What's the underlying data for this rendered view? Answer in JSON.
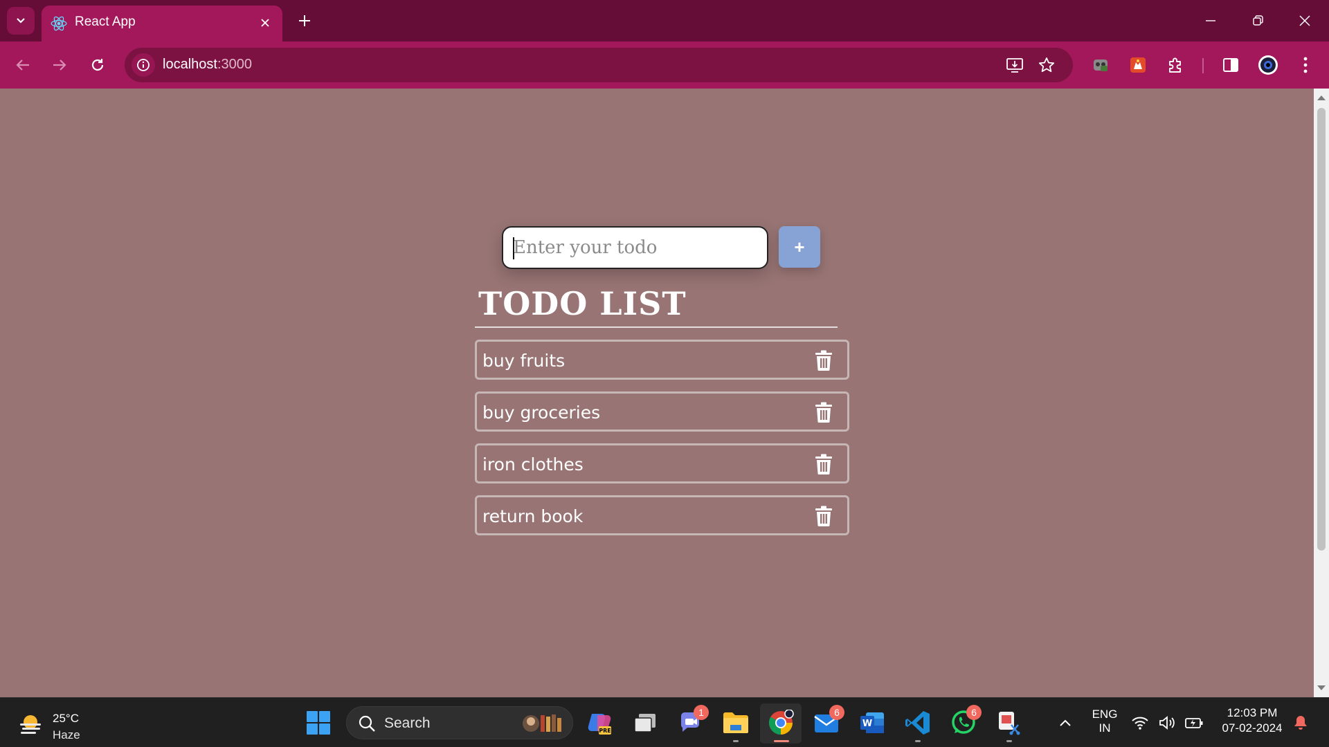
{
  "browser": {
    "tab_title": "React App",
    "url_host": "localhost",
    "url_port": ":3000"
  },
  "app": {
    "input_placeholder": "Enter your todo",
    "add_label": "+",
    "heading": "TODO LIST",
    "todos": [
      {
        "text": "buy fruits"
      },
      {
        "text": "buy groceries"
      },
      {
        "text": "iron clothes"
      },
      {
        "text": "return book"
      }
    ]
  },
  "taskbar": {
    "weather_temp": "25°C",
    "weather_condition": "Haze",
    "search_label": "Search",
    "teams_badge": "1",
    "mail_badge": "6",
    "whatsapp_badge": "6",
    "lang": "ENG",
    "region": "IN",
    "time": "12:03 PM",
    "date": "07-02-2024"
  },
  "colors": {
    "tab_strip": "#650c37",
    "toolbar": "#a3185b",
    "page_background": "#987474",
    "add_button": "#87a3d6"
  }
}
